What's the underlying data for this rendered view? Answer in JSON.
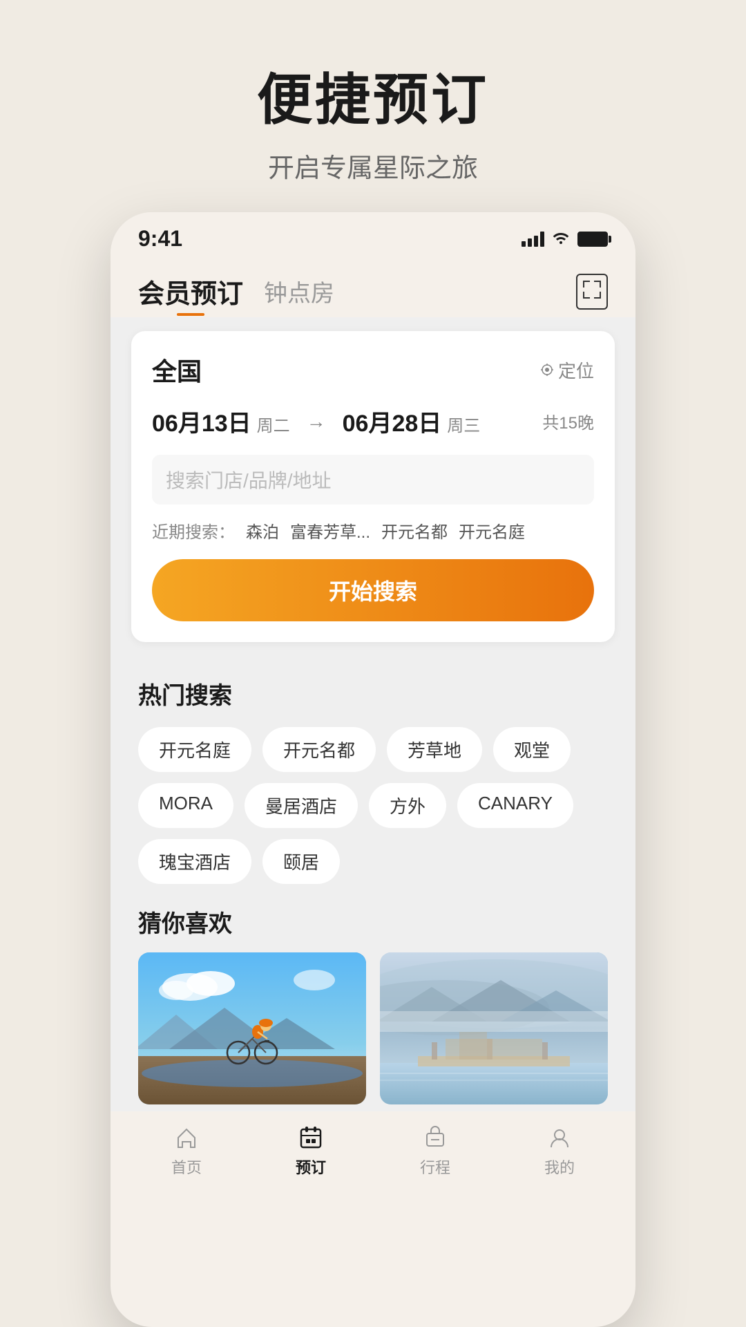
{
  "header": {
    "title": "便捷预订",
    "subtitle": "开启专属星际之旅"
  },
  "status_bar": {
    "time": "9:41",
    "signal": "signal",
    "wifi": "wifi",
    "battery": "battery"
  },
  "app_tabs": {
    "active": "会员预订",
    "inactive": "钟点房"
  },
  "search_card": {
    "location": "全国",
    "location_btn": "定位",
    "date_start": "06月13日",
    "date_start_day": "周二",
    "date_end": "06月28日",
    "date_end_day": "周三",
    "nights": "共15晚",
    "arrow": "→",
    "search_placeholder": "搜索门店/品牌/地址",
    "recent_label": "近期搜索：",
    "recent_items": [
      "森泊",
      "富春芳草...",
      "开元名都",
      "开元名庭"
    ],
    "search_btn": "开始搜索"
  },
  "hot_search": {
    "title": "热门搜索",
    "tags": [
      "开元名庭",
      "开元名都",
      "芳草地",
      "观堂",
      "MORA",
      "曼居酒店",
      "方外",
      "CANARY",
      "瑰宝酒店",
      "颐居"
    ]
  },
  "recommendations": {
    "title": "猜你喜欢"
  },
  "nav": {
    "items": [
      {
        "label": "首页",
        "icon": "🏠",
        "active": false
      },
      {
        "label": "预订",
        "icon": "📋",
        "active": true
      },
      {
        "label": "行程",
        "icon": "🧳",
        "active": false
      },
      {
        "label": "我的",
        "icon": "👤",
        "active": false
      }
    ]
  }
}
